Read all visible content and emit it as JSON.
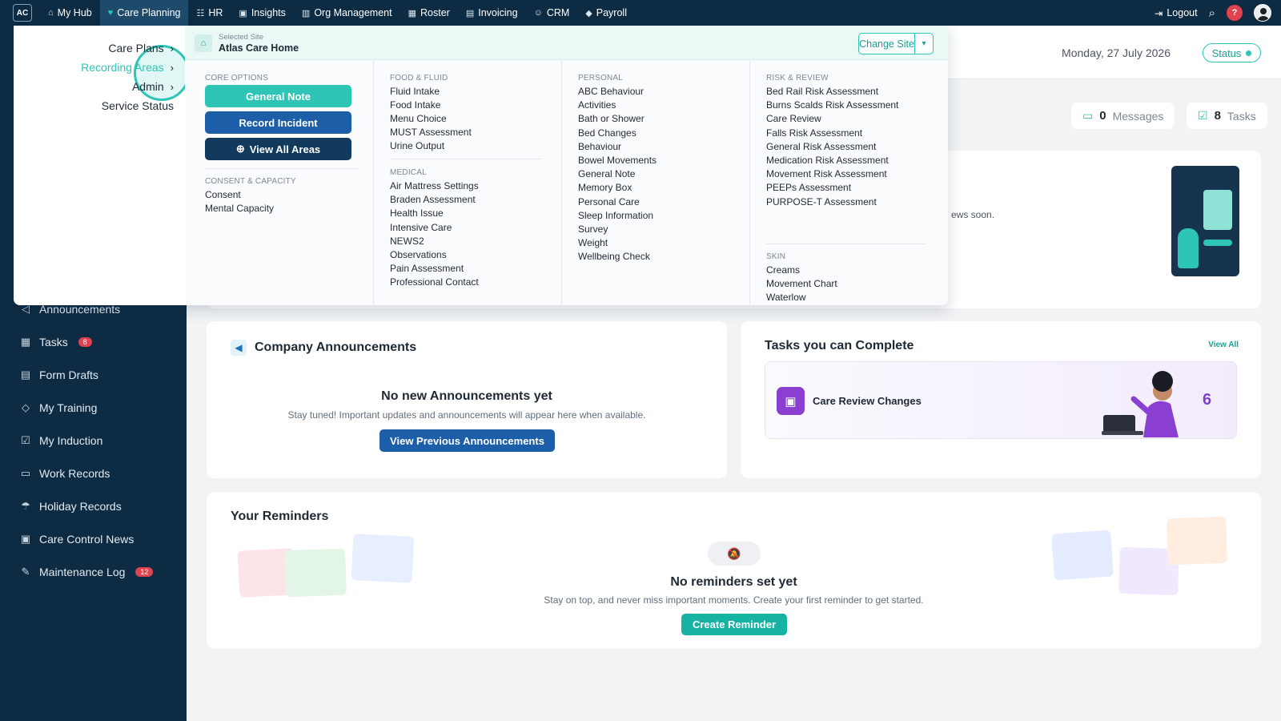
{
  "topnav": {
    "logo": "AC",
    "items": [
      {
        "label": "My Hub",
        "icon": "home-icon",
        "glyph": "⌂"
      },
      {
        "label": "Care Planning",
        "icon": "heart-icon",
        "glyph": "♥"
      },
      {
        "label": "HR",
        "icon": "people-icon",
        "glyph": "☷"
      },
      {
        "label": "Insights",
        "icon": "chart-icon",
        "glyph": "▣"
      },
      {
        "label": "Org Management",
        "icon": "building-icon",
        "glyph": "▥"
      },
      {
        "label": "Roster",
        "icon": "calendar-icon",
        "glyph": "▦"
      },
      {
        "label": "Invoicing",
        "icon": "document-icon",
        "glyph": "▤"
      },
      {
        "label": "CRM",
        "icon": "users-icon",
        "glyph": "☺"
      },
      {
        "label": "Payroll",
        "icon": "tag-icon",
        "glyph": "◆"
      }
    ],
    "active_index": 1,
    "logout": "Logout",
    "help": "?"
  },
  "sidebar": {
    "items": [
      {
        "label": "Announcements",
        "icon": "megaphone-icon",
        "glyph": "◁"
      },
      {
        "label": "Tasks",
        "icon": "calendar-icon",
        "glyph": "▦",
        "badge": "8"
      },
      {
        "label": "Form Drafts",
        "icon": "clipboard-icon",
        "glyph": "▤"
      },
      {
        "label": "My Training",
        "icon": "graduation-cap-icon",
        "glyph": "◇"
      },
      {
        "label": "My Induction",
        "icon": "checklist-icon",
        "glyph": "☑"
      },
      {
        "label": "Work Records",
        "icon": "briefcase-icon",
        "glyph": "▭"
      },
      {
        "label": "Holiday Records",
        "icon": "umbrella-icon",
        "glyph": "☂"
      },
      {
        "label": "Care Control News",
        "icon": "newspaper-icon",
        "glyph": "▣"
      },
      {
        "label": "Maintenance Log",
        "icon": "wrench-icon",
        "glyph": "✎",
        "badge": "12"
      }
    ]
  },
  "header": {
    "date": "Monday, 27 July 2026",
    "status": "Status",
    "messages_count": "0",
    "messages_label": "Messages",
    "tasks_count": "8",
    "tasks_label": "Tasks"
  },
  "news": {
    "snippet": "ews soon."
  },
  "announcements": {
    "title": "Company Announcements",
    "empty_title": "No new Announcements yet",
    "empty_sub": "Stay tuned! Important updates and announcements will appear here when available.",
    "button": "View Previous Announcements"
  },
  "tasks_card": {
    "title": "Tasks you can Complete",
    "view_all": "View All",
    "task_label": "Care Review Changes",
    "task_count": "6"
  },
  "reminders": {
    "title": "Your Reminders",
    "empty_title": "No reminders set yet",
    "empty_sub": "Stay on top, and never miss important moments. Create your first reminder to get started.",
    "button": "Create Reminder"
  },
  "mega_menu": {
    "left_items": [
      {
        "label": "Care Plans",
        "chevron": true
      },
      {
        "label": "Recording Areas",
        "chevron": true,
        "selected": true
      },
      {
        "label": "Admin",
        "chevron": true
      },
      {
        "label": "Service Status",
        "chevron": false
      }
    ],
    "site": {
      "caption": "Selected Site",
      "name": "Atlas Care Home",
      "change_label": "Change Site"
    },
    "core_options": {
      "heading": "CORE OPTIONS",
      "buttons": [
        "General Note",
        "Record Incident",
        "View All Areas"
      ]
    },
    "consent": {
      "heading": "CONSENT & CAPACITY",
      "items": [
        "Consent",
        "Mental Capacity"
      ]
    },
    "food_fluid": {
      "heading": "FOOD & FLUID",
      "items": [
        "Fluid Intake",
        "Food Intake",
        "Menu Choice",
        "MUST Assessment",
        "Urine Output"
      ]
    },
    "medical": {
      "heading": "MEDICAL",
      "items": [
        "Air Mattress Settings",
        "Braden Assessment",
        "Health Issue",
        "Intensive Care",
        "NEWS2",
        "Observations",
        "Pain Assessment",
        "Professional Contact"
      ]
    },
    "personal": {
      "heading": "PERSONAL",
      "items": [
        "ABC Behaviour",
        "Activities",
        "Bath or Shower",
        "Bed Changes",
        "Behaviour",
        "Bowel Movements",
        "General Note",
        "Memory Box",
        "Personal Care",
        "Sleep Information",
        "Survey",
        "Weight",
        "Wellbeing Check"
      ]
    },
    "risk_review": {
      "heading": "RISK & REVIEW",
      "items": [
        "Bed Rail Risk Assessment",
        "Burns Scalds Risk Assessment",
        "Care Review",
        "Falls Risk Assessment",
        "General Risk Assessment",
        "Medication Risk Assessment",
        "Movement Risk Assessment",
        "PEEPs Assessment",
        "PURPOSE-T Assessment"
      ]
    },
    "skin": {
      "heading": "SKIN",
      "items": [
        "Creams",
        "Movement Chart",
        "Waterlow"
      ]
    }
  },
  "colors": {
    "navy": "#0d2c44",
    "teal": "#2ec4b6",
    "blue": "#1d5ea8",
    "dark_blue": "#123a5c",
    "purple": "#8a3fd1",
    "danger": "#e0424f"
  }
}
